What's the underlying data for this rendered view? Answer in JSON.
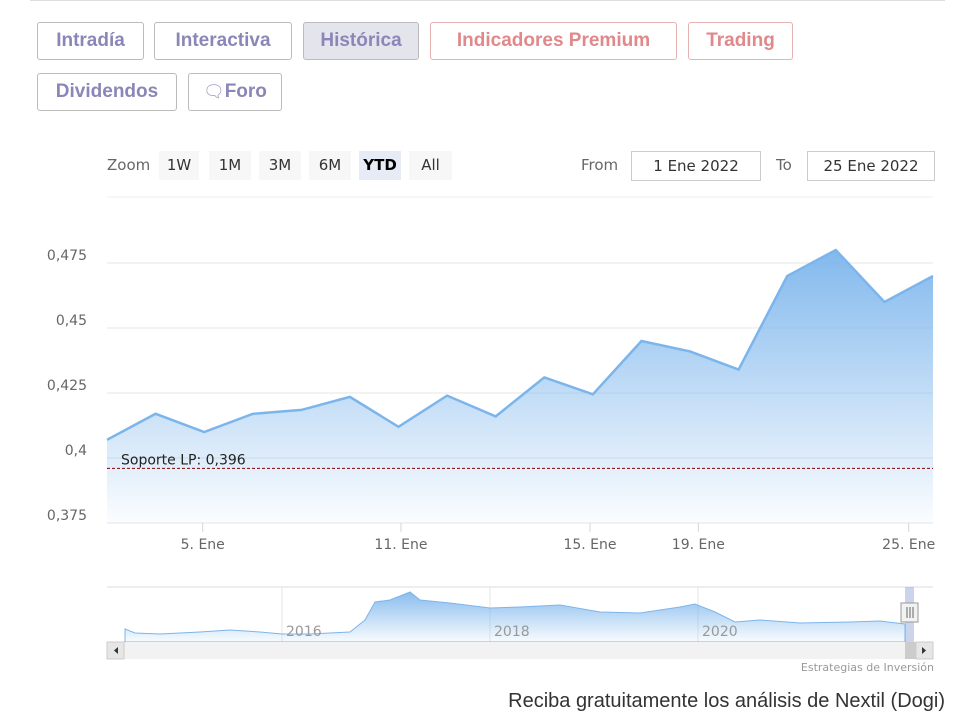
{
  "tabs": [
    {
      "label": "Intradía",
      "state": "normal"
    },
    {
      "label": "Interactiva",
      "state": "normal"
    },
    {
      "label": "Histórica",
      "state": "active"
    },
    {
      "label": "Indicadores Premium",
      "state": "premium"
    },
    {
      "label": "Trading",
      "state": "premium"
    },
    {
      "label": "Dividendos",
      "state": "normal"
    },
    {
      "label": "Foro",
      "state": "normal",
      "icon": "speech-bubble-icon"
    }
  ],
  "range_selector": {
    "zoom_label": "Zoom",
    "buttons": [
      "1W",
      "1M",
      "3M",
      "6M",
      "YTD",
      "All"
    ],
    "selected": "YTD",
    "from_label": "From",
    "from_value": "1 Ene 2022",
    "to_label": "To",
    "to_value": "25 Ene 2022"
  },
  "chart_data": {
    "type": "area",
    "x": [
      "3 Ene",
      "4 Ene",
      "5 Ene",
      "6 Ene",
      "7 Ene",
      "10 Ene",
      "11 Ene",
      "12 Ene",
      "13 Ene",
      "14 Ene",
      "17 Ene",
      "18 Ene",
      "19 Ene",
      "20 Ene",
      "21 Ene",
      "24 Ene",
      "25 Ene",
      "26 Ene"
    ],
    "values": [
      0.407,
      0.417,
      0.41,
      0.417,
      0.4185,
      0.4235,
      0.412,
      0.424,
      0.416,
      0.431,
      0.4245,
      0.445,
      0.441,
      0.434,
      0.47,
      0.48,
      0.46,
      0.47
    ],
    "ylim": [
      0.375,
      0.48
    ],
    "y_ticks": [
      "0,375",
      "0,4",
      "0,425",
      "0,45",
      "0,475"
    ],
    "y_tick_values": [
      0.375,
      0.4,
      0.425,
      0.45,
      0.475
    ],
    "x_ticks": [
      "5. Ene",
      "11. Ene",
      "15. Ene",
      "19. Ene",
      "25. Ene"
    ],
    "support_line": {
      "label": "Soporte LP: 0,396",
      "value": 0.396,
      "color": "#8b0000"
    },
    "series_color": "#7cb5ec",
    "grid": true,
    "navigator": {
      "year_labels": [
        "2016",
        "2018",
        "2020"
      ]
    }
  },
  "credits": "Estrategias de Inversión",
  "footer": "Reciba gratuitamente los análisis de Nextil (Dogi)"
}
